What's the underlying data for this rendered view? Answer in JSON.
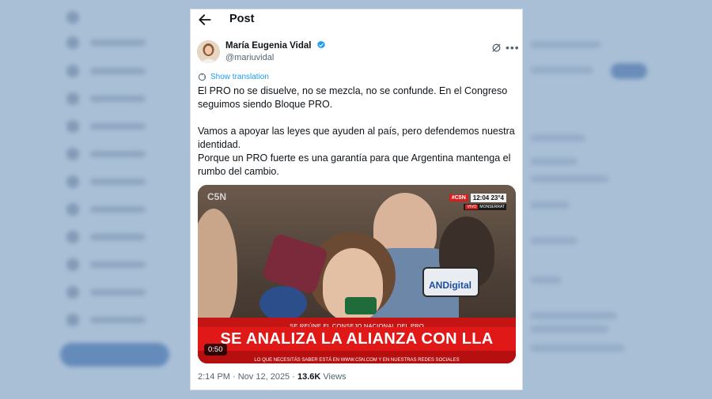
{
  "header": {
    "title": "Post"
  },
  "author": {
    "name": "María Eugenia Vidal",
    "handle": "@mariuvidal"
  },
  "post": {
    "translate_label": "Show translation",
    "paragraph_1": "El PRO no se disuelve, no se mezcla, no se confunde. En el Congreso seguimos siendo Bloque PRO.",
    "paragraph_2": "Vamos a apoyar las leyes que ayuden al país, pero defendemos nuestra identidad.",
    "paragraph_3": "Porque un PRO fuerte es una garantía para que Argentina mantenga el rumbo del cambio."
  },
  "video": {
    "channel_logo": "C5N",
    "live_badge": "#C5N",
    "live_time": "12:04 23°4",
    "live_badge_small": "VIVO",
    "location": "MONSERRAT",
    "mic_logo": "ANDigital",
    "strip_text": "SE REÚNE EL CONSEJO NACIONAL DEL PRO",
    "headline": "SE ANALIZA LA ALIANZA CON LLA",
    "ticker": "LO QUE NECESITÁS SABER ESTÁ EN WWW.C5N.COM Y EN NUESTRAS REDES SOCIALES",
    "duration": "0:50"
  },
  "meta": {
    "timestamp": "2:14 PM · Nov 12, 2025 · ",
    "views_count": "13.6K",
    "views_label": " Views"
  },
  "colors": {
    "accent": "#1d9bf0",
    "verified": "#1d9bf0",
    "headline_red": "#e01818"
  }
}
